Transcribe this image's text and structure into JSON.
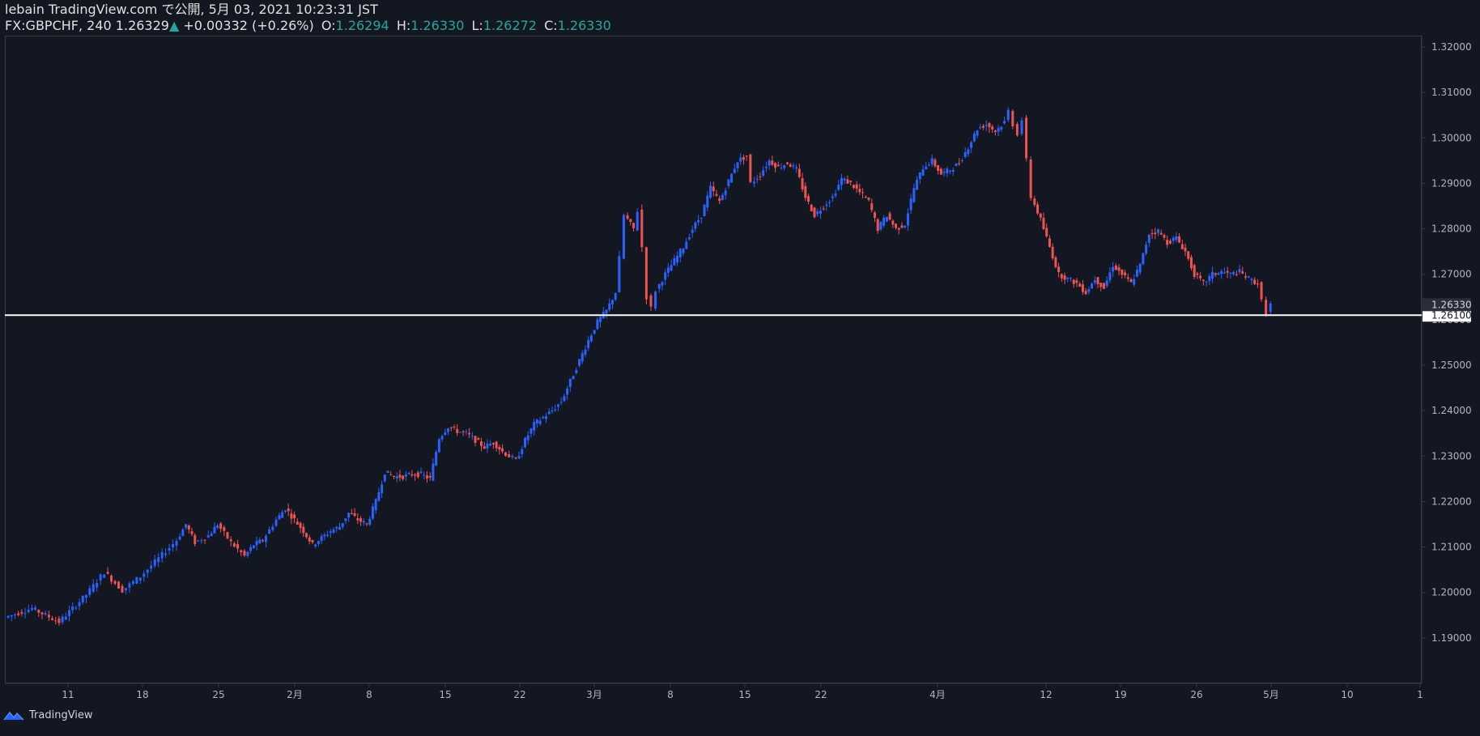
{
  "header": {
    "publish_line": "lebain TradingView.com で公開, 5月 03, 2021 10:23:31 JST",
    "symbol": "FX:GBPCHF, 240",
    "last_price": "1.26329",
    "change": "+0.00332 (+0.26%)",
    "open_label": "O:",
    "open": "1.26294",
    "high_label": "H:",
    "high": "1.26330",
    "low_label": "L:",
    "low": "1.26272",
    "close_label": "C:",
    "close": "1.26330"
  },
  "footer": {
    "brand": "TradingView"
  },
  "colors": {
    "background": "#131722",
    "bull": "#2962ff",
    "bear": "#ef5350",
    "grid": "#363a45",
    "axis_text": "#b2b5be",
    "horizontal_line": "#ffffff",
    "last_price_label": "#d1d4dc"
  },
  "chart_data": {
    "type": "candlestick",
    "symbol": "FX:GBPCHF",
    "timeframe": "240",
    "ylim": [
      1.18,
      1.3225
    ],
    "y_ticks": [
      "1.32000",
      "1.31000",
      "1.30000",
      "1.29000",
      "1.28000",
      "1.27000",
      "1.26000",
      "1.25000",
      "1.24000",
      "1.23000",
      "1.22000",
      "1.21000",
      "1.20000",
      "1.19000"
    ],
    "x_ticks": [
      "11",
      "18",
      "25",
      "2月",
      "8",
      "15",
      "22",
      "3月",
      "8",
      "15",
      "22",
      "4月",
      "12",
      "19",
      "26",
      "5月",
      "10",
      "1"
    ],
    "price_label_current": "1.26330",
    "horizontal_line": {
      "value": 1.261,
      "label": "1.26100"
    },
    "series_path": [
      [
        0,
        1.1945
      ],
      [
        6,
        1.1965
      ],
      [
        12,
        1.1935
      ],
      [
        18,
        1.1995
      ],
      [
        22,
        1.2045
      ],
      [
        26,
        1.2005
      ],
      [
        30,
        1.2035
      ],
      [
        34,
        1.2075
      ],
      [
        38,
        1.2115
      ],
      [
        40,
        1.215
      ],
      [
        42,
        1.211
      ],
      [
        45,
        1.2125
      ],
      [
        47,
        1.215
      ],
      [
        50,
        1.211
      ],
      [
        53,
        1.208
      ],
      [
        55,
        1.2105
      ],
      [
        57,
        1.2115
      ],
      [
        60,
        1.216
      ],
      [
        62,
        1.2185
      ],
      [
        64,
        1.216
      ],
      [
        66,
        1.2135
      ],
      [
        68,
        1.2105
      ],
      [
        70,
        1.212
      ],
      [
        72,
        1.2135
      ],
      [
        74,
        1.2145
      ],
      [
        76,
        1.2175
      ],
      [
        78,
        1.216
      ],
      [
        80,
        1.215
      ],
      [
        82,
        1.22
      ],
      [
        84,
        1.2265
      ],
      [
        86,
        1.2255
      ],
      [
        88,
        1.2255
      ],
      [
        90,
        1.226
      ],
      [
        92,
        1.226
      ],
      [
        94,
        1.225
      ],
      [
        96,
        1.234
      ],
      [
        98,
        1.2365
      ],
      [
        100,
        1.2355
      ],
      [
        102,
        1.235
      ],
      [
        104,
        1.2335
      ],
      [
        106,
        1.232
      ],
      [
        108,
        1.233
      ],
      [
        110,
        1.231
      ],
      [
        113,
        1.229
      ],
      [
        115,
        1.2335
      ],
      [
        117,
        1.237
      ],
      [
        119,
        1.2385
      ],
      [
        121,
        1.24
      ],
      [
        123,
        1.242
      ],
      [
        125,
        1.2465
      ],
      [
        127,
        1.251
      ],
      [
        129,
        1.2555
      ],
      [
        131,
        1.2595
      ],
      [
        133,
        1.262
      ],
      [
        135,
        1.266
      ],
      [
        136,
        1.2735
      ],
      [
        137,
        1.283
      ],
      [
        139,
        1.28
      ],
      [
        140,
        1.284
      ],
      [
        141,
        1.276
      ],
      [
        142,
        1.265
      ],
      [
        143,
        1.2625
      ],
      [
        144,
        1.2665
      ],
      [
        146,
        1.27
      ],
      [
        148,
        1.273
      ],
      [
        150,
        1.276
      ],
      [
        152,
        1.28
      ],
      [
        154,
        1.283
      ],
      [
        156,
        1.289
      ],
      [
        158,
        1.286
      ],
      [
        160,
        1.2905
      ],
      [
        162,
        1.295
      ],
      [
        164,
        1.296
      ],
      [
        165,
        1.29
      ],
      [
        167,
        1.292
      ],
      [
        169,
        1.295
      ],
      [
        171,
        1.2935
      ],
      [
        173,
        1.2945
      ],
      [
        175,
        1.293
      ],
      [
        177,
        1.287
      ],
      [
        179,
        1.283
      ],
      [
        181,
        1.285
      ],
      [
        183,
        1.287
      ],
      [
        185,
        1.291
      ],
      [
        187,
        1.29
      ],
      [
        189,
        1.288
      ],
      [
        191,
        1.286
      ],
      [
        193,
        1.28
      ],
      [
        195,
        1.283
      ],
      [
        197,
        1.28
      ],
      [
        199,
        1.281
      ],
      [
        201,
        1.289
      ],
      [
        203,
        1.2935
      ],
      [
        205,
        1.295
      ],
      [
        207,
        1.292
      ],
      [
        209,
        1.293
      ],
      [
        211,
        1.2945
      ],
      [
        213,
        1.298
      ],
      [
        215,
        1.302
      ],
      [
        217,
        1.303
      ],
      [
        219,
        1.3015
      ],
      [
        221,
        1.3035
      ],
      [
        222,
        1.306
      ],
      [
        223,
        1.303
      ],
      [
        224,
        1.301
      ],
      [
        225,
        1.304
      ],
      [
        226,
        1.295
      ],
      [
        227,
        1.287
      ],
      [
        229,
        1.282
      ],
      [
        231,
        1.276
      ],
      [
        233,
        1.27
      ],
      [
        235,
        1.269
      ],
      [
        237,
        1.268
      ],
      [
        239,
        1.266
      ],
      [
        241,
        1.269
      ],
      [
        243,
        1.267
      ],
      [
        245,
        1.272
      ],
      [
        247,
        1.27
      ],
      [
        249,
        1.268
      ],
      [
        251,
        1.272
      ],
      [
        253,
        1.279
      ],
      [
        255,
        1.2795
      ],
      [
        257,
        1.277
      ],
      [
        259,
        1.278
      ],
      [
        261,
        1.275
      ],
      [
        263,
        1.27
      ],
      [
        265,
        1.268
      ],
      [
        267,
        1.27
      ],
      [
        269,
        1.2705
      ],
      [
        271,
        1.27
      ],
      [
        273,
        1.2705
      ],
      [
        275,
        1.269
      ],
      [
        277,
        1.268
      ],
      [
        278,
        1.264
      ],
      [
        279,
        1.2615
      ],
      [
        280,
        1.2633
      ]
    ]
  }
}
